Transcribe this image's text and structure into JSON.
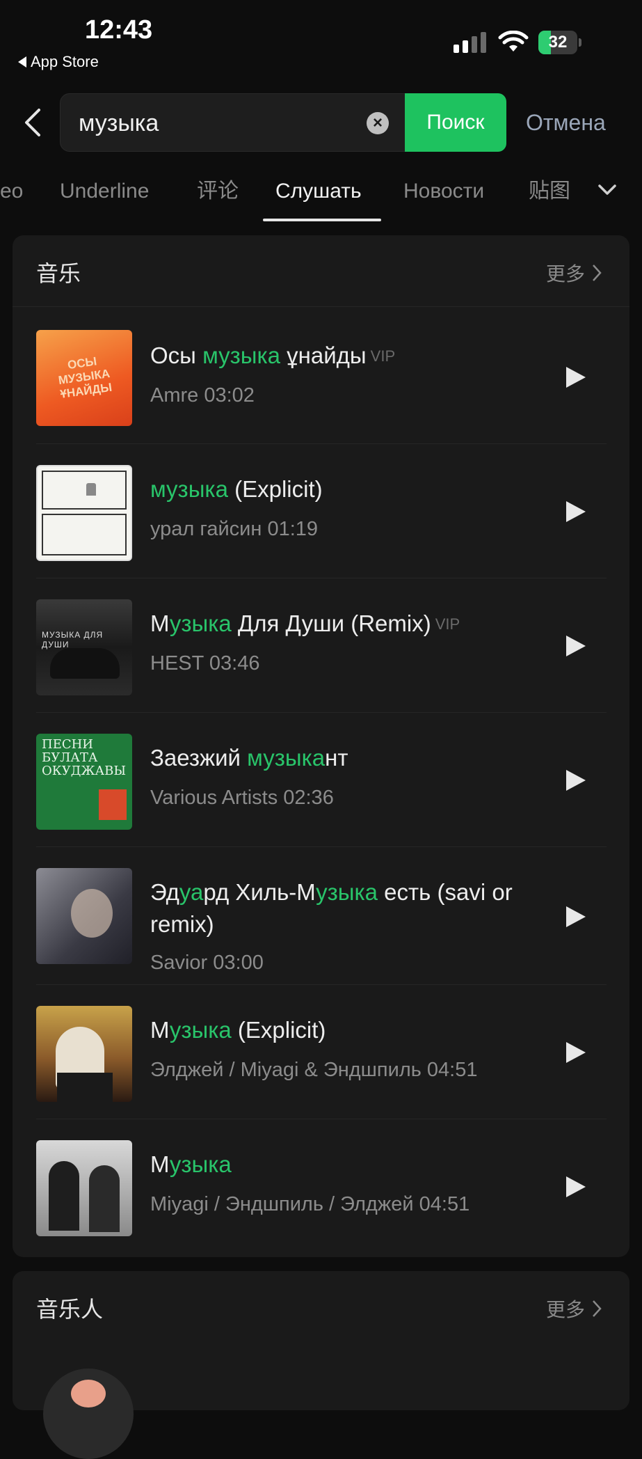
{
  "status_bar": {
    "time": "12:43",
    "back_app": "App Store",
    "battery": "32",
    "battery_level": 0.32
  },
  "search": {
    "query": "музыка",
    "button": "Поиск",
    "cancel": "Отмена"
  },
  "tabs": [
    {
      "label": "eo"
    },
    {
      "label": "Underline"
    },
    {
      "label": "评论"
    },
    {
      "label": "Слушать",
      "active": true
    },
    {
      "label": "Новости"
    },
    {
      "label": "贴图"
    }
  ],
  "music_section": {
    "title": "音乐",
    "more": "更多",
    "songs": [
      {
        "title_parts": [
          "Осы ",
          "музыка",
          " ұнайды"
        ],
        "vip": "VIP",
        "meta": "Amre 03:02"
      },
      {
        "title_parts": [
          "",
          "музыка",
          " (Explicit)"
        ],
        "vip": "",
        "meta": "урал гайсин 01:19"
      },
      {
        "title_parts": [
          "М",
          "узыка",
          " Для Души (Remix)"
        ],
        "vip": "VIP",
        "meta": "HEST 03:46"
      },
      {
        "title_parts": [
          "Заезжий ",
          "музыка",
          "нт"
        ],
        "vip": "",
        "meta": "Various Artists 02:36"
      },
      {
        "title_parts": [
          "Эд",
          "уа",
          "рд Хиль-М",
          "узыка",
          " есть (savi or remix)"
        ],
        "vip": "",
        "meta": "Savior 03:00"
      },
      {
        "title_parts": [
          "М",
          "узыка",
          " (Explicit)"
        ],
        "vip": "",
        "meta": "Элджей / Miyagi & Эндшпиль 04:51"
      },
      {
        "title_parts": [
          "М",
          "узыка",
          ""
        ],
        "vip": "",
        "meta": "Miyagi / Эндшпиль / Элджей 04:51"
      }
    ],
    "cover_texts": {
      "c1": "ОСЫ МУЗЫКА ҰНАЙДЫ",
      "c4": "ПЕСНИ БУЛАТА ОКУДЖАВЫ"
    }
  },
  "artists_section": {
    "title": "音乐人",
    "more": "更多"
  },
  "colors": {
    "accent": "#29c46a",
    "search_button": "#1ec25f"
  }
}
